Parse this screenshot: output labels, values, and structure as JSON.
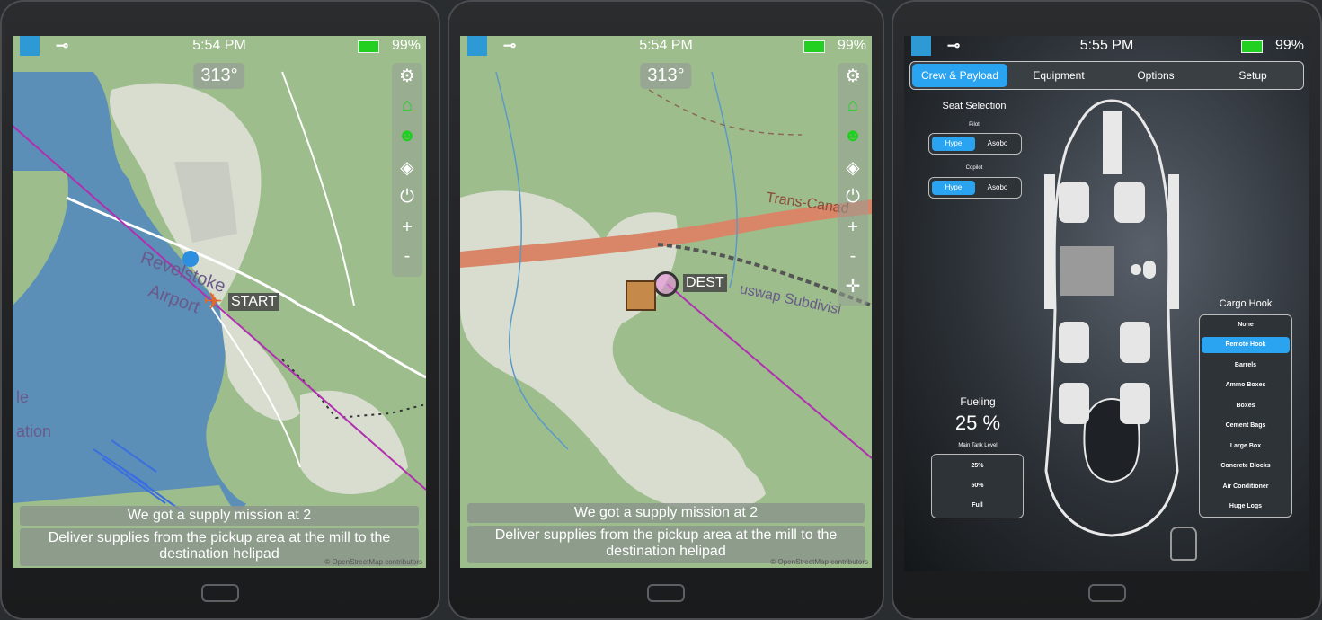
{
  "panels": [
    {
      "status": {
        "time": "5:54 PM",
        "battery": "99%"
      },
      "heading": "313°",
      "marker_label": "START",
      "map_text": {
        "place1": "Revelstoke",
        "place2": "Airport",
        "place3": "le",
        "place4": "ation"
      },
      "messages": [
        "We got a supply mission at 2",
        "Deliver supplies from the pickup area at the mill to the destination helipad"
      ],
      "credit": "© OpenStreetMap contributors"
    },
    {
      "status": {
        "time": "5:54 PM",
        "battery": "99%"
      },
      "heading": "313°",
      "marker_label": "DEST",
      "map_text": {
        "road": "Trans-Canad",
        "rail": "uswap Subdivisi"
      },
      "messages": [
        "We got a supply mission at 2",
        "Deliver supplies from the pickup area at the mill to the destination helipad"
      ],
      "credit": "© OpenStreetMap contributors"
    },
    {
      "status": {
        "time": "5:55 PM",
        "battery": "99%"
      },
      "tabs": [
        "Crew & Payload",
        "Equipment",
        "Options",
        "Setup"
      ],
      "active_tab": "Crew & Payload",
      "seat_selection": {
        "title": "Seat Selection",
        "pilot": {
          "label": "Pilot",
          "options": [
            "Hype",
            "Asobo"
          ],
          "selected": "Hype"
        },
        "copilot": {
          "label": "Copilot",
          "options": [
            "Hype",
            "Asobo"
          ],
          "selected": "Hype"
        }
      },
      "fueling": {
        "title": "Fueling",
        "value": "25 %",
        "sublabel": "Main Tank Level",
        "options": [
          "25%",
          "50%",
          "Full"
        ]
      },
      "cargo_hook": {
        "title": "Cargo Hook",
        "options": [
          "None",
          "Remote Hook",
          "Barrels",
          "Ammo Boxes",
          "Boxes",
          "Cement Bags",
          "Large Box",
          "Concrete Blocks",
          "Air Conditioner",
          "Huge Logs"
        ],
        "selected": "Remote Hook"
      }
    }
  ],
  "colors": {
    "accent": "#2aa3f0",
    "route": "#b030b0",
    "battery": "#22d022",
    "marker": "#e06a2a"
  },
  "icons": [
    "app-icon",
    "plug-icon",
    "battery-icon",
    "gear-icon",
    "museum-icon",
    "person-icon",
    "layers-icon",
    "power-icon",
    "zoom-in-icon",
    "zoom-out-icon",
    "crosshair-icon",
    "helicopter-icon",
    "sawmill-icon",
    "seat-icon"
  ]
}
